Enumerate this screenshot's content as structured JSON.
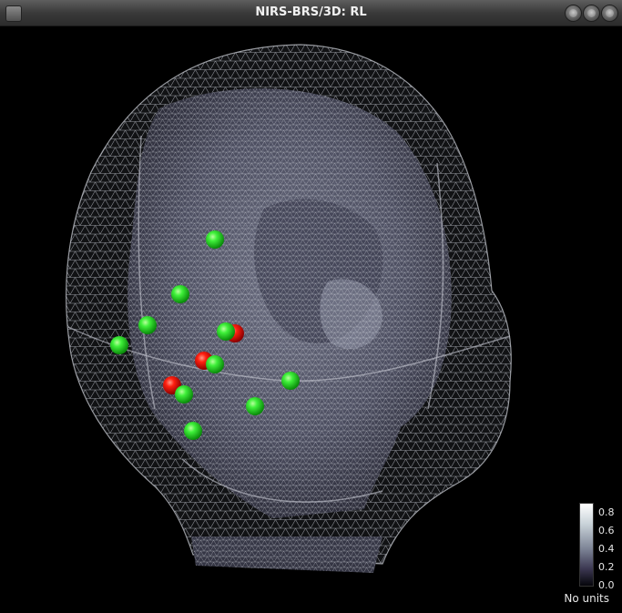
{
  "window": {
    "title": "NIRS-BRS/3D: RL"
  },
  "colors": {
    "background": "#000000",
    "mesh": "#cfd3da",
    "cortex": "#6b6d82",
    "sensor_green": "#22e81f",
    "sensor_red": "#ff1a0a"
  },
  "sensors": {
    "green_count": 13,
    "red_count": 3
  },
  "colorbar": {
    "ticks": [
      "0.8",
      "0.6",
      "0.4",
      "0.2",
      "0.0"
    ],
    "units_label": "No units"
  },
  "icons": {
    "menu": "window-menu-icon",
    "buttons": [
      "minimize-icon",
      "maximize-icon",
      "close-icon"
    ]
  }
}
